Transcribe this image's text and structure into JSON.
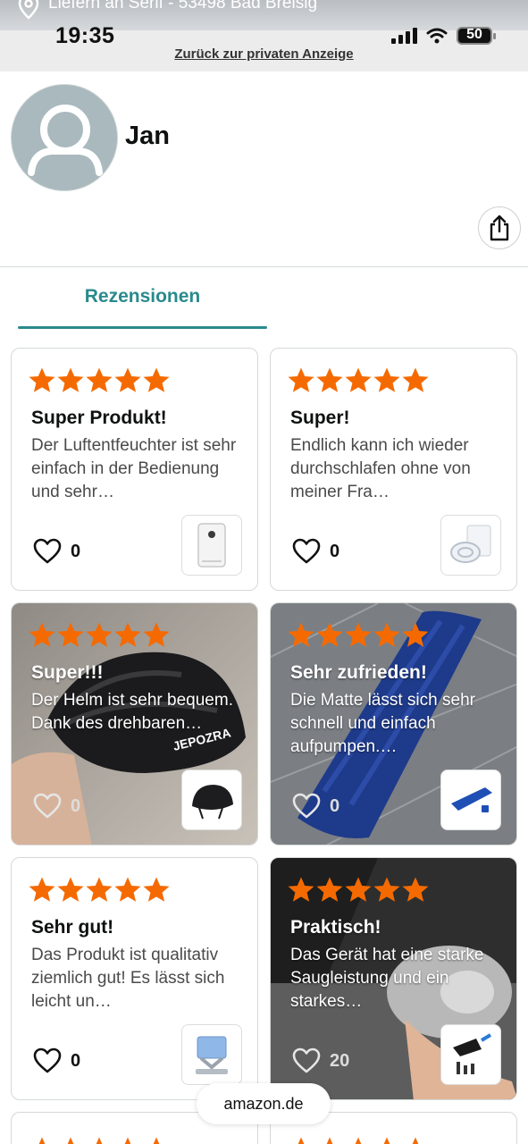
{
  "status": {
    "deliver_text": "Liefern an Serif - 53498 Bad Breisig",
    "time": "19:35",
    "battery": "50"
  },
  "header": {
    "back_link": "Zurück zur privaten Anzeige"
  },
  "profile": {
    "name": "Jan"
  },
  "tabs": [
    {
      "label": "Rezensionen",
      "active": true
    }
  ],
  "reviews": [
    {
      "stars": 5,
      "title": "Super Produkt!",
      "body": "Der Luftentfeuchter ist sehr einfach in der Bedienung und sehr…",
      "likes": "0",
      "thumb_icon": "dehumidifier-icon"
    },
    {
      "stars": 5,
      "title": "Super!",
      "body": "Endlich kann ich wieder durchschlafen ohne von meiner Fra…",
      "likes": "0",
      "thumb_icon": "anti-snore-icon"
    },
    {
      "stars": 5,
      "title": "Super!!!",
      "body": "Der Helm ist sehr bequem. Dank des drehbaren…",
      "likes": "0",
      "thumb_icon": "helmet-icon"
    },
    {
      "stars": 5,
      "title": "Sehr zufrieden!",
      "body": "Die Matte lässt sich sehr schnell und einfach aufpumpen.…",
      "likes": "0",
      "thumb_icon": "mattress-icon"
    },
    {
      "stars": 5,
      "title": "Sehr gut!",
      "body": "Das Produkt ist qualitativ ziemlich gut! Es lässt sich leicht un…",
      "likes": "0",
      "thumb_icon": "stand-icon"
    },
    {
      "stars": 5,
      "title": "Praktisch!",
      "body": "Das Gerät hat eine starke Saugleistung und ein starkes…",
      "likes": "20",
      "thumb_icon": "vacuum-icon"
    }
  ],
  "footer": {
    "domain": "amazon.de"
  },
  "colors": {
    "accent": "#2a8a8c",
    "star": "#f56a00"
  }
}
